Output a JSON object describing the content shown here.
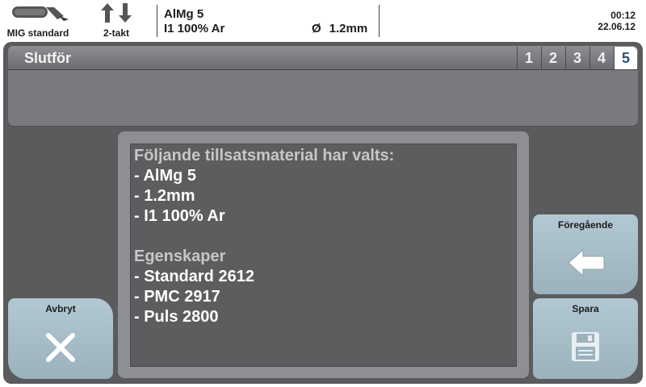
{
  "status": {
    "process": {
      "icon": "mig-torch-icon",
      "label": "MIG standard"
    },
    "trigger": {
      "icon": "up-down-arrows-icon",
      "label": "2-takt"
    },
    "material": "AlMg 5",
    "gas": "I1 100% Ar",
    "diameter_symbol": "Ø",
    "diameter": "1.2mm",
    "time": "00:12",
    "date": "22.06.12"
  },
  "wizard": {
    "title": "Slutför",
    "steps": [
      "1",
      "2",
      "3",
      "4",
      "5"
    ],
    "active_step": "5"
  },
  "summary": {
    "heading": "Följande tillsatsmaterial har valts:",
    "materials": [
      "- AlMg 5",
      "- 1.2mm",
      "- I1 100% Ar"
    ],
    "properties_heading": "Egenskaper",
    "properties": [
      "- Standard 2612",
      "- PMC 2917",
      "- Puls 2800"
    ]
  },
  "buttons": {
    "cancel": {
      "label": "Avbryt",
      "icon": "close-x-icon"
    },
    "previous": {
      "label": "Föregående",
      "icon": "left-arrow-icon"
    },
    "save": {
      "label": "Spara",
      "icon": "floppy-disk-icon"
    }
  },
  "colors": {
    "button_face": "#a8bfca",
    "panel_dark": "#5a5b5d",
    "active_step_text": "#2e4f6e"
  }
}
